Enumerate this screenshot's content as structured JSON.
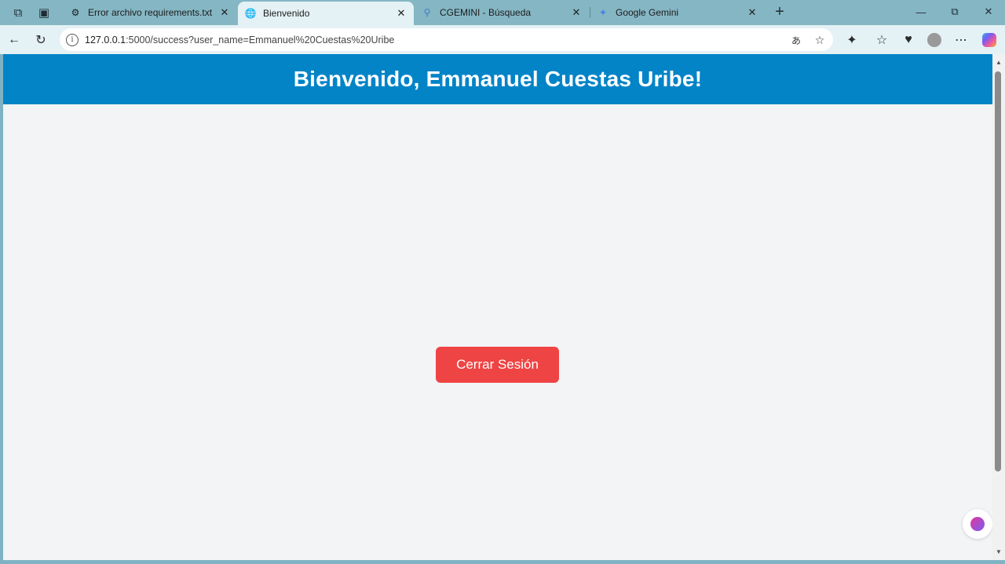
{
  "browser": {
    "tabs": [
      {
        "title": "Error archivo requirements.txt",
        "favicon": "settings-icon"
      },
      {
        "title": "Bienvenido",
        "favicon": "globe-icon",
        "active": true
      },
      {
        "title": "CGEMINI - Búsqueda",
        "favicon": "search-icon"
      },
      {
        "title": "Google Gemini",
        "favicon": "gemini-icon"
      }
    ],
    "address": {
      "host": "127.0.0.1",
      "rest": ":5000/success?user_name=Emmanuel%20Cuestas%20Uribe"
    },
    "colors": {
      "tabstrip": "#85b6c4",
      "toolbar": "#e4f1f5"
    }
  },
  "page": {
    "header_title": "Bienvenido, Emmanuel Cuestas Uribe!",
    "logout_label": "Cerrar Sesión",
    "colors": {
      "header": "#0284c7",
      "background": "#f3f4f6",
      "logout": "#ef4444"
    }
  }
}
